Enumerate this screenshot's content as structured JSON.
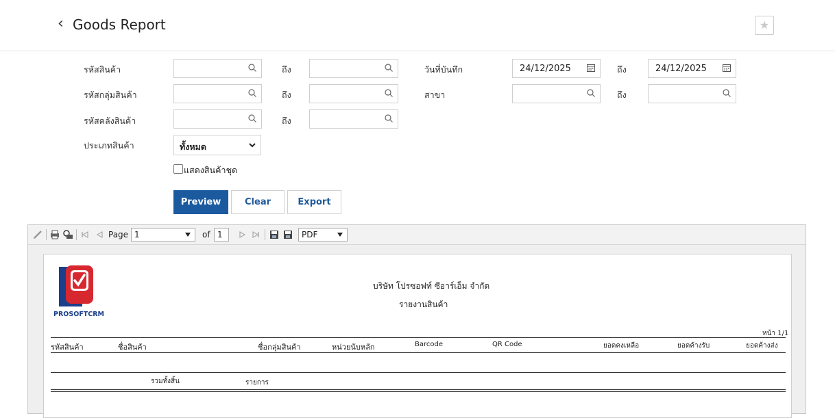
{
  "header": {
    "title": "Goods Report"
  },
  "filters": {
    "product_code_label": "รหัสสินค้า",
    "product_group_label": "รหัสกลุ่มสินค้า",
    "warehouse_label": "รหัสคลังสินค้า",
    "product_type_label": "ประเภทสินค้า",
    "to_label": "ถึง",
    "record_date_label": "วันที่บันทึก",
    "branch_label": "สาขา",
    "date_from": "24/12/2025",
    "date_to": "24/12/2025",
    "product_type_value": "ทั้งหมด",
    "show_set_label": "แสดงสินค้าชุด"
  },
  "buttons": {
    "preview": "Preview",
    "clear": "Clear",
    "export": "Export"
  },
  "viewer": {
    "page_label": "Page",
    "page_value": "1",
    "of_label": "of",
    "total_pages": "1",
    "format": "PDF"
  },
  "report": {
    "logo_text": "PROSOFTCRM",
    "company": "บริษัท โปรซอฟท์ ซีอาร์เอ็ม จำกัด",
    "title": "รายงานสินค้า",
    "page_info": "หน้า 1/1",
    "columns": [
      "รหัสสินค้า",
      "ชื่อสินค้า",
      "ชื่อกลุ่มสินค้า",
      "หน่วยนับหลัก",
      "Barcode",
      "QR Code",
      "ยอดคงเหลือ",
      "ยอดค้างรับ",
      "ยอดค้างส่ง"
    ],
    "total_label": "รวมทั้งสิ้น",
    "items_label": "รายการ"
  },
  "colors": {
    "primary": "#1c5aa0",
    "logo_red": "#d7282f"
  }
}
